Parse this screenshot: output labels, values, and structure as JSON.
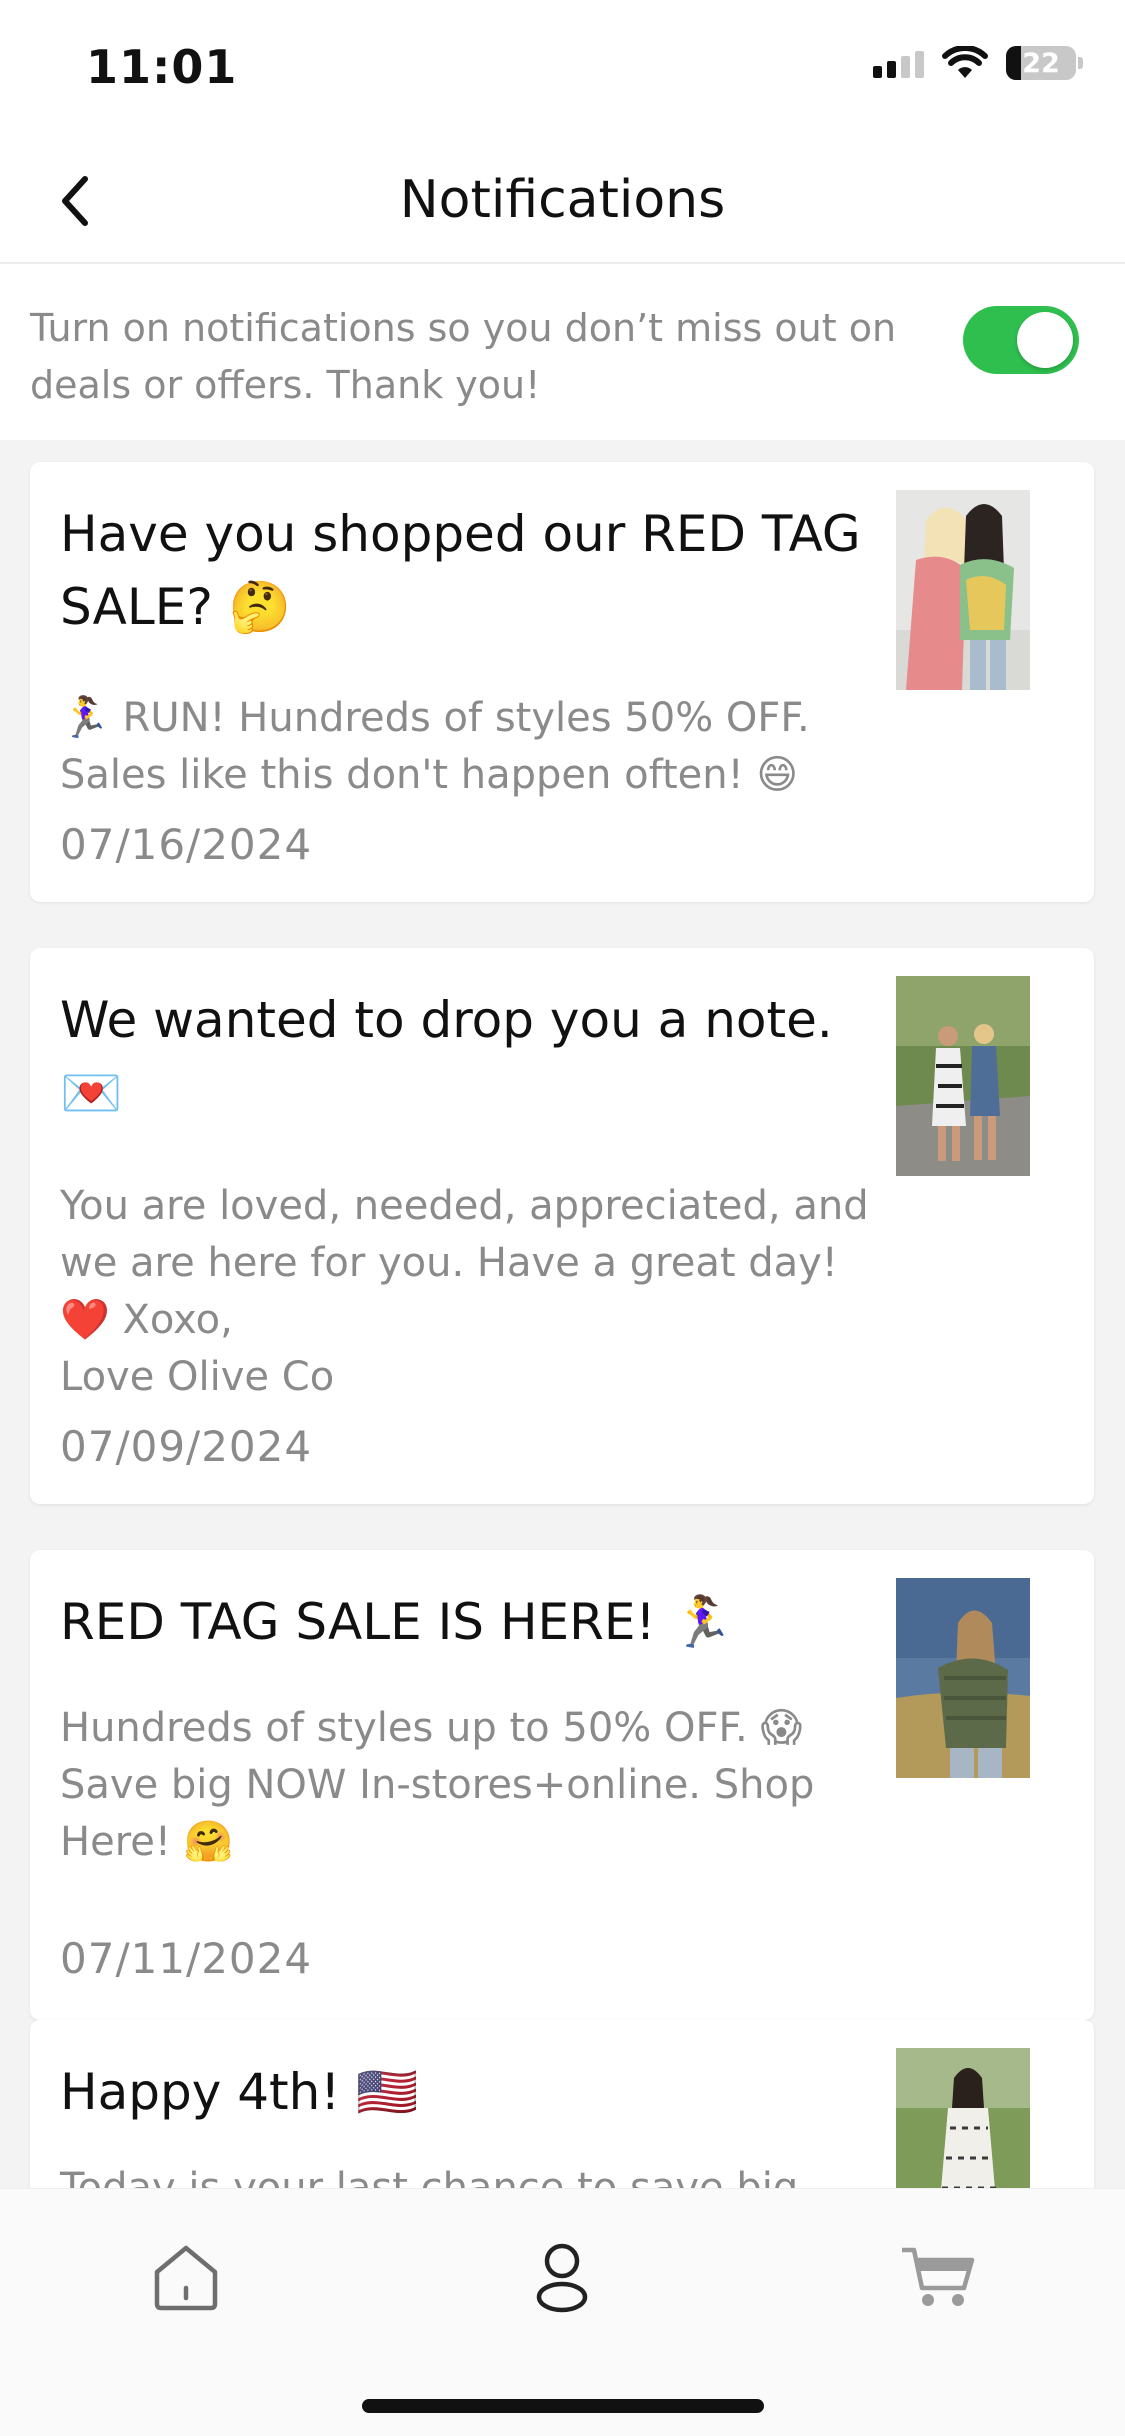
{
  "status_bar": {
    "time": "11:01",
    "battery": "22",
    "battery_level": 0.22,
    "icons": [
      "signal-icon",
      "wifi-icon",
      "battery-icon"
    ]
  },
  "header": {
    "title": "Notifications",
    "back_icon": "chevron-left-icon"
  },
  "optin": {
    "text": "Turn on notifications so you don’t miss out on deals or offers. Thank you!",
    "toggle_on": true,
    "toggle_color": "#2fbf4f"
  },
  "notifications": [
    {
      "title": "Have you shopped our RED TAG SALE? 🤔",
      "body": "🏃‍♀️ RUN! Hundreds of styles 50% OFF. Sales like this don't happen often! 😄",
      "date": "07/16/2024",
      "image": "two-women-hugging-photo"
    },
    {
      "title": "We wanted to drop you a note. 💌",
      "body": "You are loved, needed, appreciated, and we are here for you. Have a great day!\n❤️ Xoxo,\nLove Olive Co",
      "date": "07/09/2024",
      "image": "two-women-walking-photo"
    },
    {
      "title": "RED TAG SALE IS HERE! 🏃‍♀️",
      "body": "Hundreds of styles up to 50% OFF. 😱 Save big NOW In-stores+online. Shop Here! 🤗",
      "date": "07/11/2024",
      "image": "woman-in-field-photo"
    },
    {
      "title": "Happy 4th! 🇺🇸",
      "body": "Today is your last chance to save big. Use",
      "date": "",
      "image": "woman-in-dress-photo"
    }
  ],
  "bottom_nav": {
    "items": [
      "home-icon",
      "account-icon",
      "cart-icon"
    ]
  },
  "colors": {
    "accent_toggle": "#2fbf4f",
    "text_primary": "#111111",
    "text_secondary": "#8a8a8a",
    "list_background": "#f3f3f3"
  }
}
